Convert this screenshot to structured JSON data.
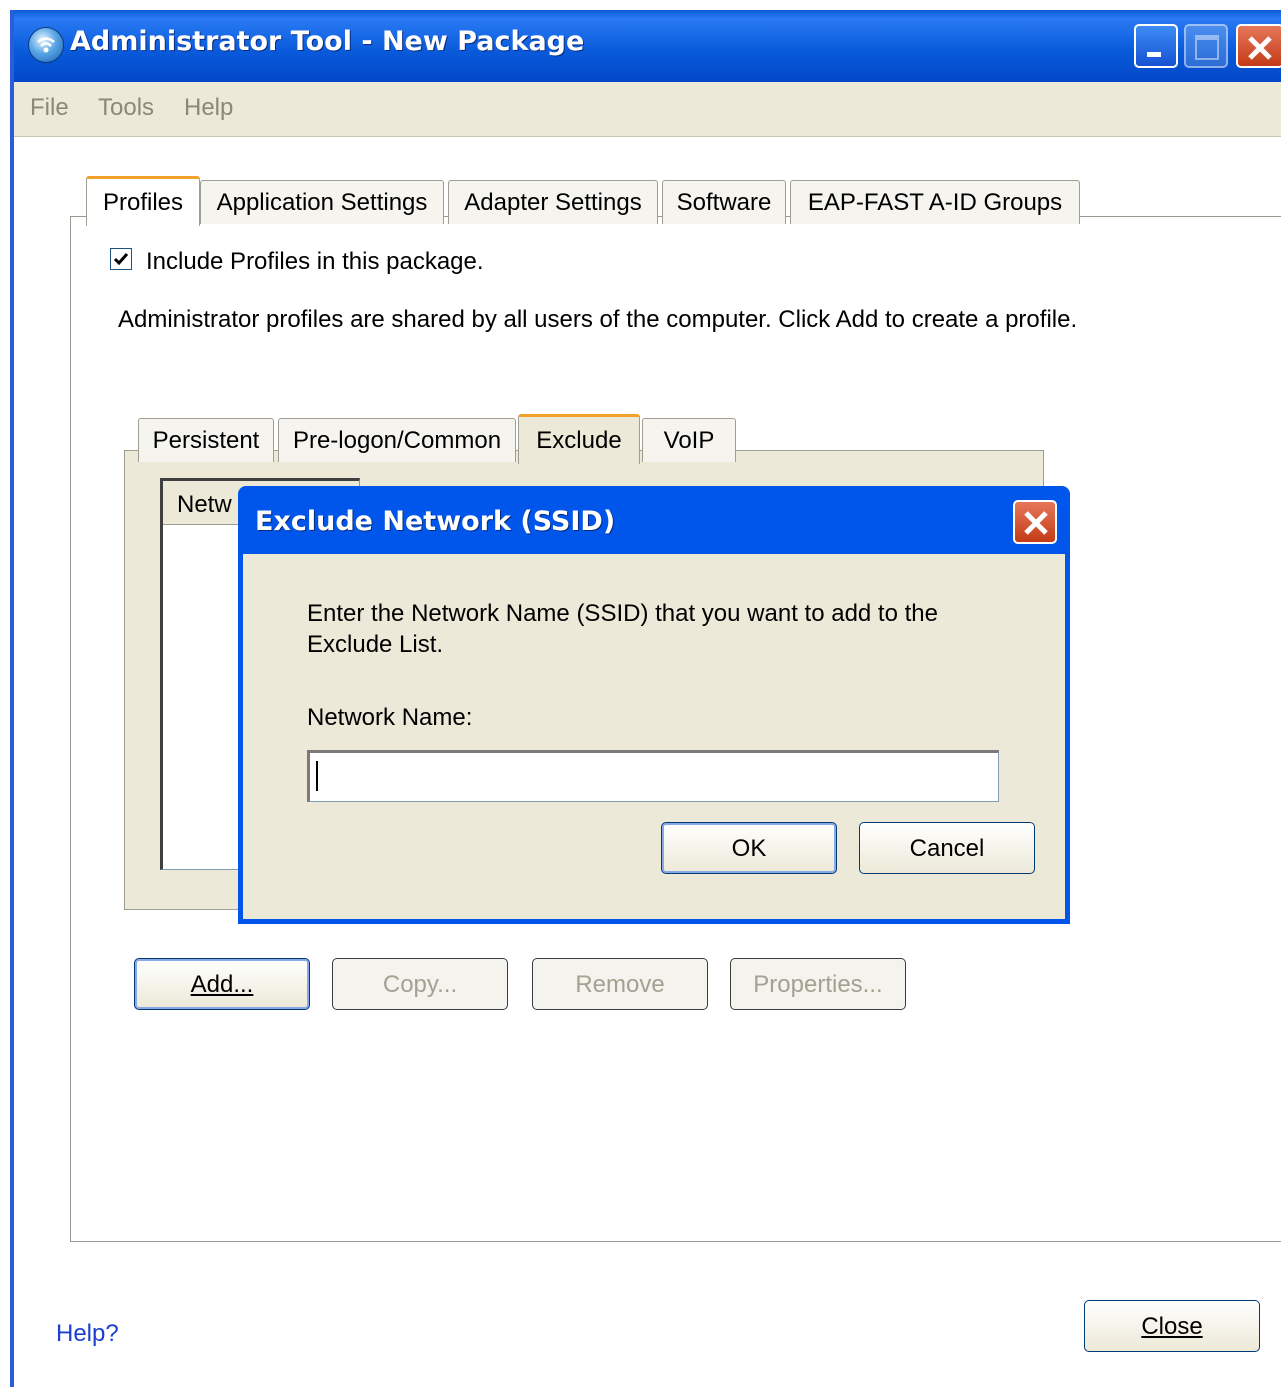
{
  "window": {
    "title": "Administrator Tool - New Package"
  },
  "menu": [
    "File",
    "Tools",
    "Help"
  ],
  "tabs": [
    "Profiles",
    "Application Settings",
    "Adapter Settings",
    "Software",
    "EAP-FAST A-ID Groups"
  ],
  "profiles": {
    "include_label": "Include Profiles in this package.",
    "include_checked": true,
    "description": "Administrator profiles are shared by all users of the computer. Click Add to create a profile.",
    "subtabs": [
      "Persistent",
      "Pre-logon/Common",
      "Exclude",
      "VoIP"
    ],
    "list_header": "Netw",
    "buttons": {
      "add": "Add...",
      "copy": "Copy...",
      "remove": "Remove",
      "properties": "Properties..."
    }
  },
  "dialog": {
    "title": "Exclude Network (SSID)",
    "message": "Enter the Network Name (SSID) that you want to add to the Exclude List.",
    "network_label": "Network Name:",
    "network_value": "",
    "ok": "OK",
    "cancel": "Cancel"
  },
  "footer": {
    "help": "Help?",
    "close": "Close"
  },
  "icons": [
    "app-wireless-icon",
    "minimize-icon",
    "maximize-icon",
    "close-icon",
    "checkmark-icon"
  ]
}
